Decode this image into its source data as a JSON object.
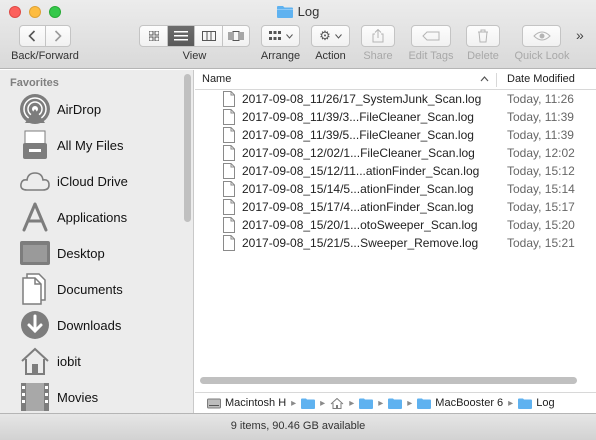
{
  "window": {
    "title": "Log"
  },
  "toolbar": {
    "back_forward_label": "Back/Forward",
    "view_label": "View",
    "arrange_label": "Arrange",
    "action_label": "Action",
    "share_label": "Share",
    "edit_tags_label": "Edit Tags",
    "delete_label": "Delete",
    "quick_look_label": "Quick Look",
    "overflow_glyph": "»"
  },
  "sidebar": {
    "heading": "Favorites",
    "items": [
      {
        "label": "AirDrop",
        "icon": "airdrop-icon"
      },
      {
        "label": "All My Files",
        "icon": "all-my-files-icon"
      },
      {
        "label": "iCloud Drive",
        "icon": "icloud-icon"
      },
      {
        "label": "Applications",
        "icon": "applications-icon"
      },
      {
        "label": "Desktop",
        "icon": "desktop-icon"
      },
      {
        "label": "Documents",
        "icon": "documents-icon"
      },
      {
        "label": "Downloads",
        "icon": "downloads-icon"
      },
      {
        "label": "iobit",
        "icon": "home-icon"
      },
      {
        "label": "Movies",
        "icon": "movies-icon"
      }
    ]
  },
  "list": {
    "col_name": "Name",
    "col_date": "Date Modified",
    "rows": [
      {
        "name": "2017-09-08_11/26/17_SystemJunk_Scan.log",
        "date": "Today, 11:26"
      },
      {
        "name": "2017-09-08_11/39/3...FileCleaner_Scan.log",
        "date": "Today, 11:39"
      },
      {
        "name": "2017-09-08_11/39/5...FileCleaner_Scan.log",
        "date": "Today, 11:39"
      },
      {
        "name": "2017-09-08_12/02/1...FileCleaner_Scan.log",
        "date": "Today, 12:02"
      },
      {
        "name": "2017-09-08_15/12/11...ationFinder_Scan.log",
        "date": "Today, 15:12"
      },
      {
        "name": "2017-09-08_15/14/5...ationFinder_Scan.log",
        "date": "Today, 15:14"
      },
      {
        "name": "2017-09-08_15/17/4...ationFinder_Scan.log",
        "date": "Today, 15:17"
      },
      {
        "name": "2017-09-08_15/20/1...otoSweeper_Scan.log",
        "date": "Today, 15:20"
      },
      {
        "name": "2017-09-08_15/21/5...Sweeper_Remove.log",
        "date": "Today, 15:21"
      }
    ]
  },
  "pathbar": {
    "disk": "Macintosh H",
    "folder_named": "MacBooster 6",
    "current": "Log"
  },
  "status": {
    "text": "9 items, 90.46 GB available"
  },
  "colors": {
    "folder_blue": "#5fb2f0",
    "accent": "#3478f6"
  }
}
